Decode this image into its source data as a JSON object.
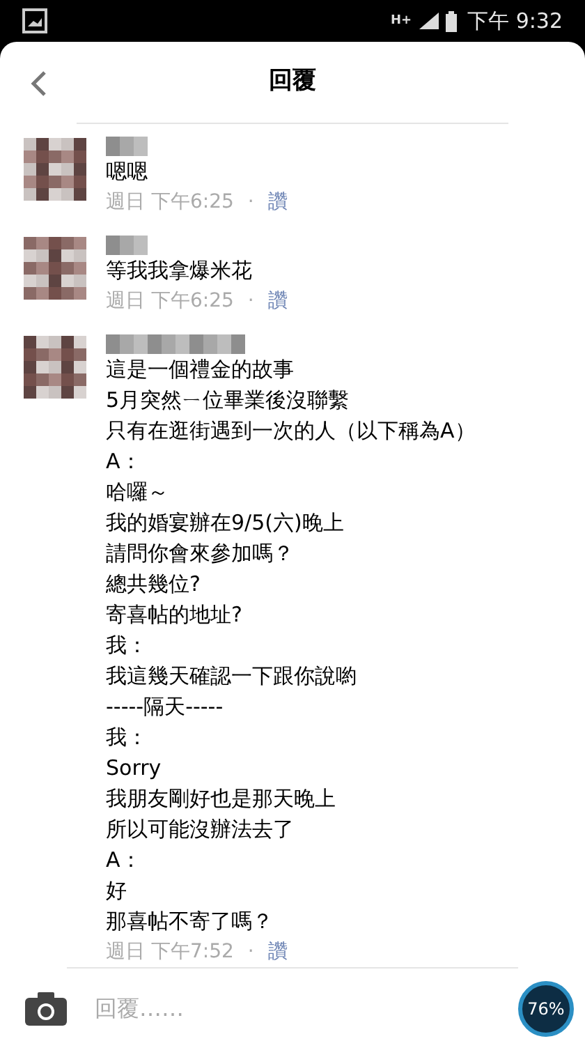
{
  "status_bar": {
    "network": "H+",
    "time": "下午 9:32"
  },
  "header": {
    "title": "回覆"
  },
  "comments": [
    {
      "lines": [
        "嗯嗯"
      ],
      "time": "週日 下午6:25",
      "separator": "·",
      "like": "讚"
    },
    {
      "lines": [
        "等我我拿爆米花"
      ],
      "time": "週日 下午6:25",
      "separator": "·",
      "like": "讚"
    },
    {
      "lines": [
        "這是一個禮金的故事",
        "5月突然ㄧ位畢業後沒聯繫",
        "只有在逛街遇到一次的人（以下稱為A）",
        "A：",
        "哈囉～",
        "我的婚宴辦在9/5(六)晚上",
        "請問你會來參加嗎？",
        "總共幾位?",
        "寄喜帖的地址?",
        "我：",
        "我這幾天確認一下跟你說喲",
        "-----隔天-----",
        "我：",
        "Sorry",
        "我朋友剛好也是那天晚上",
        "所以可能沒辦法去了",
        "A：",
        "好",
        "那喜帖不寄了嗎？"
      ],
      "time": "週日 下午7:52",
      "separator": "·",
      "like": "讚"
    }
  ],
  "reply_bar": {
    "placeholder": "回覆……"
  },
  "battery_widget": {
    "text": "76%"
  }
}
